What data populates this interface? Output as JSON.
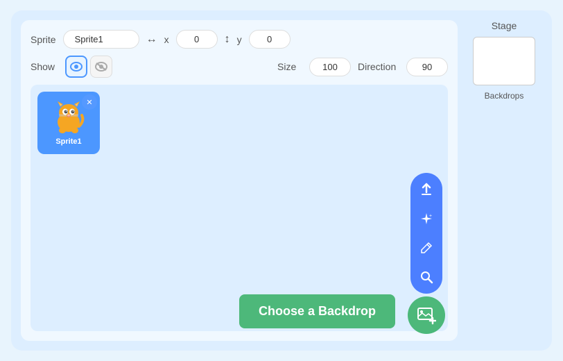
{
  "header": {
    "sprite_label": "Sprite",
    "sprite_name": "Sprite1",
    "x_label": "x",
    "y_label": "y",
    "x_value": "0",
    "y_value": "0",
    "show_label": "Show",
    "size_label": "Size",
    "size_value": "100",
    "direction_label": "Direction",
    "direction_value": "90"
  },
  "stage": {
    "label": "Stage",
    "backdrop_label": "Backdrops"
  },
  "sprite_card": {
    "name": "Sprite1",
    "delete_icon": "✕"
  },
  "backdrop_button": {
    "label": "Choose a Backdrop"
  },
  "actions": {
    "upload_icon": "⬆",
    "sparkle_icon": "✦",
    "paint_icon": "✏",
    "search_icon": "🔍",
    "add_icon": "🖼"
  }
}
